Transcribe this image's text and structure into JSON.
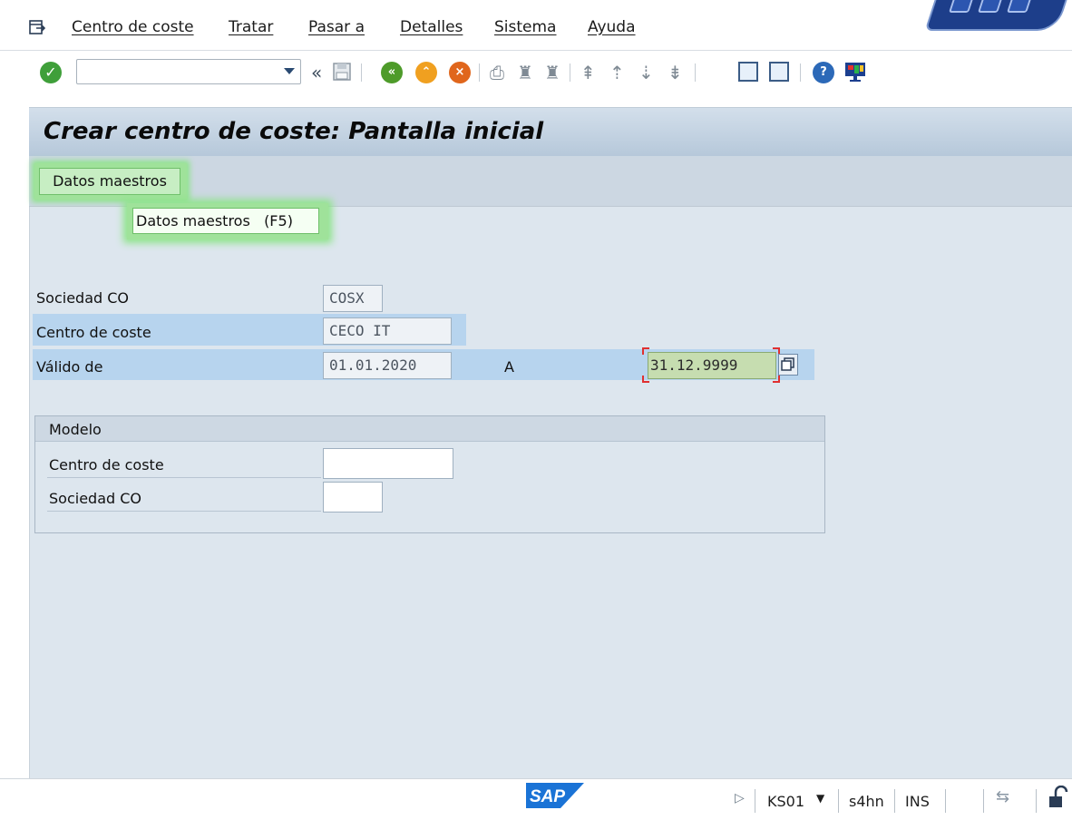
{
  "menubar": {
    "items": [
      "Centro de coste",
      "Tratar",
      "Pasar a",
      "Detalles",
      "Sistema",
      "Ayuda"
    ]
  },
  "toolbar": {
    "command_field_value": "",
    "icons": [
      "check-icon",
      "back-arrows-icon",
      "save-icon",
      "back-icon",
      "exit-icon",
      "cancel-icon",
      "print-icon",
      "find-icon",
      "find-next-icon",
      "first-page-icon",
      "previous-page-icon",
      "next-page-icon",
      "last-page-icon",
      "new-session-icon",
      "shortcut-icon",
      "help-icon",
      "customize-layout-icon"
    ]
  },
  "title": "Crear centro de coste: Pantalla inicial",
  "appbar": {
    "datos_maestros_button": "Datos maestros",
    "tooltip": "Datos maestros   (F5)"
  },
  "form": {
    "sociedad_co_label": "Sociedad CO",
    "sociedad_co_value": "COSX",
    "centro_coste_label": "Centro de coste",
    "centro_coste_value": "CECO IT",
    "valido_de_label": "Válido de",
    "valido_de_value": "01.01.2020",
    "a_label": "A",
    "valido_a_value": "31.12.9999"
  },
  "modelo": {
    "group_title": "Modelo",
    "centro_coste_label": "Centro de coste",
    "centro_coste_value": "",
    "sociedad_co_label": "Sociedad CO",
    "sociedad_co_value": ""
  },
  "statusbar": {
    "logo": "SAP",
    "transaction": "KS01",
    "system": "s4hn",
    "mode": "INS"
  },
  "colors": {
    "title_bar": "#c4d4e4",
    "highlight_row": "#b7d4ee",
    "focused_button": "#9fe29a",
    "sap_blue": "#1d6fd6"
  }
}
